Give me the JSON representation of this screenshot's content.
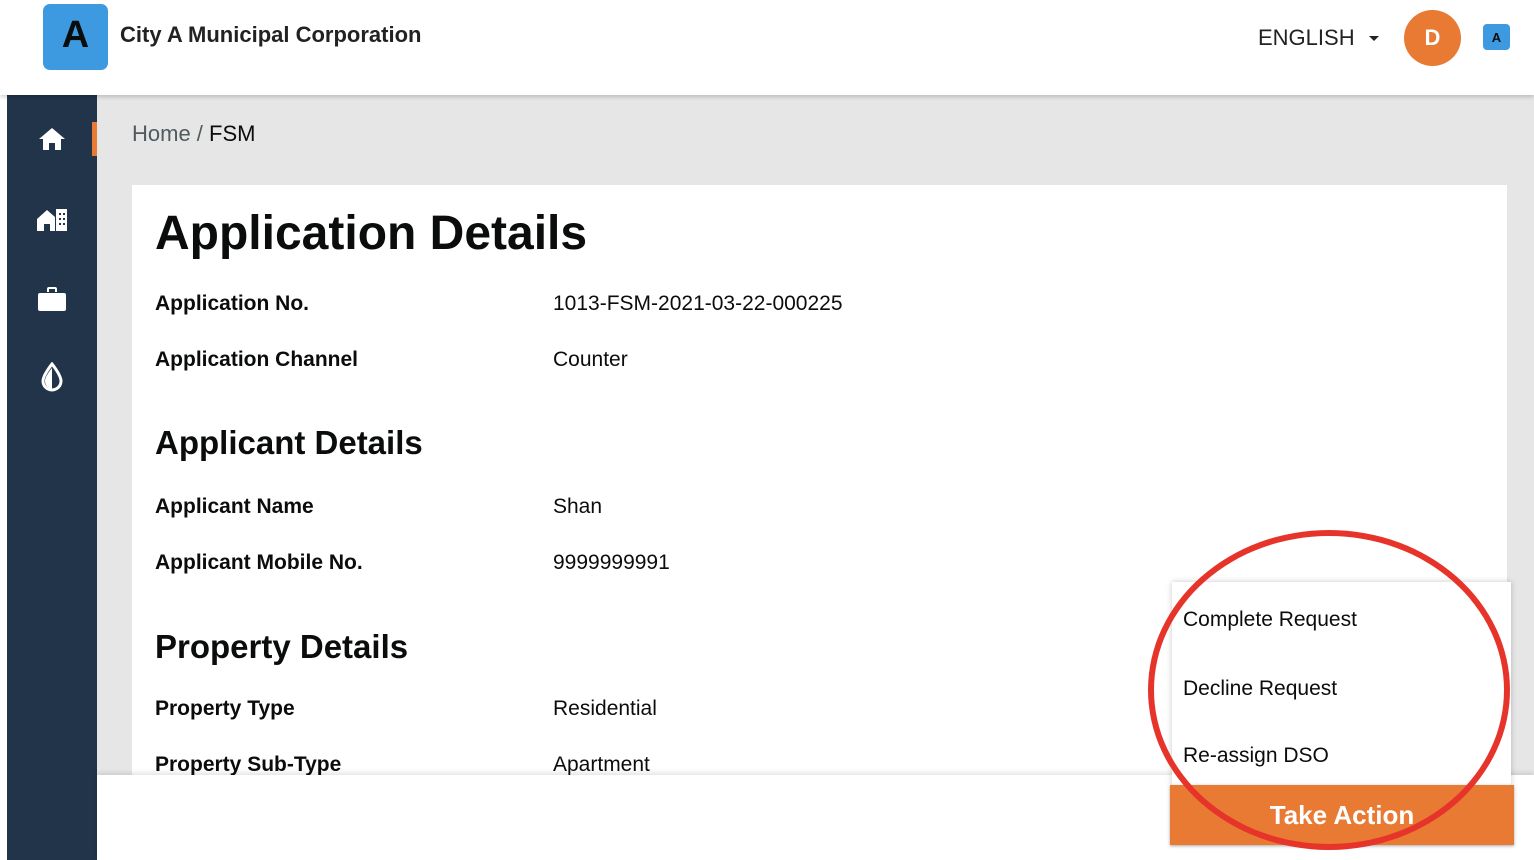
{
  "header": {
    "logo_letter": "A",
    "city_name": "City A Municipal Corporation",
    "language": "ENGLISH",
    "avatar_initial": "D",
    "badge_letter": "A"
  },
  "sidebar": {
    "items": [
      {
        "icon": "home-icon"
      },
      {
        "icon": "building-icon"
      },
      {
        "icon": "briefcase-icon"
      },
      {
        "icon": "water-drop-icon"
      }
    ],
    "accent_color": "#e87a33",
    "background_color": "#21344a"
  },
  "breadcrumb": {
    "home": "Home",
    "separator": " / ",
    "current": "FSM"
  },
  "application": {
    "title": "Application Details",
    "rows": [
      {
        "label": "Application No.",
        "value": "1013-FSM-2021-03-22-000225"
      },
      {
        "label": "Application Channel",
        "value": "Counter"
      }
    ]
  },
  "applicant": {
    "title": "Applicant Details",
    "rows": [
      {
        "label": "Applicant Name",
        "value": "Shan"
      },
      {
        "label": "Applicant Mobile No.",
        "value": "9999999991"
      }
    ]
  },
  "property": {
    "title": "Property Details",
    "rows": [
      {
        "label": "Property Type",
        "value": "Residential"
      },
      {
        "label": "Property Sub-Type",
        "value": "Apartment"
      }
    ]
  },
  "action_menu": {
    "items": [
      "Complete Request",
      "Decline Request",
      "Re-assign DSO"
    ],
    "button_label": "Take Action",
    "button_color": "#e87a33",
    "highlight_color": "#e6342a"
  }
}
